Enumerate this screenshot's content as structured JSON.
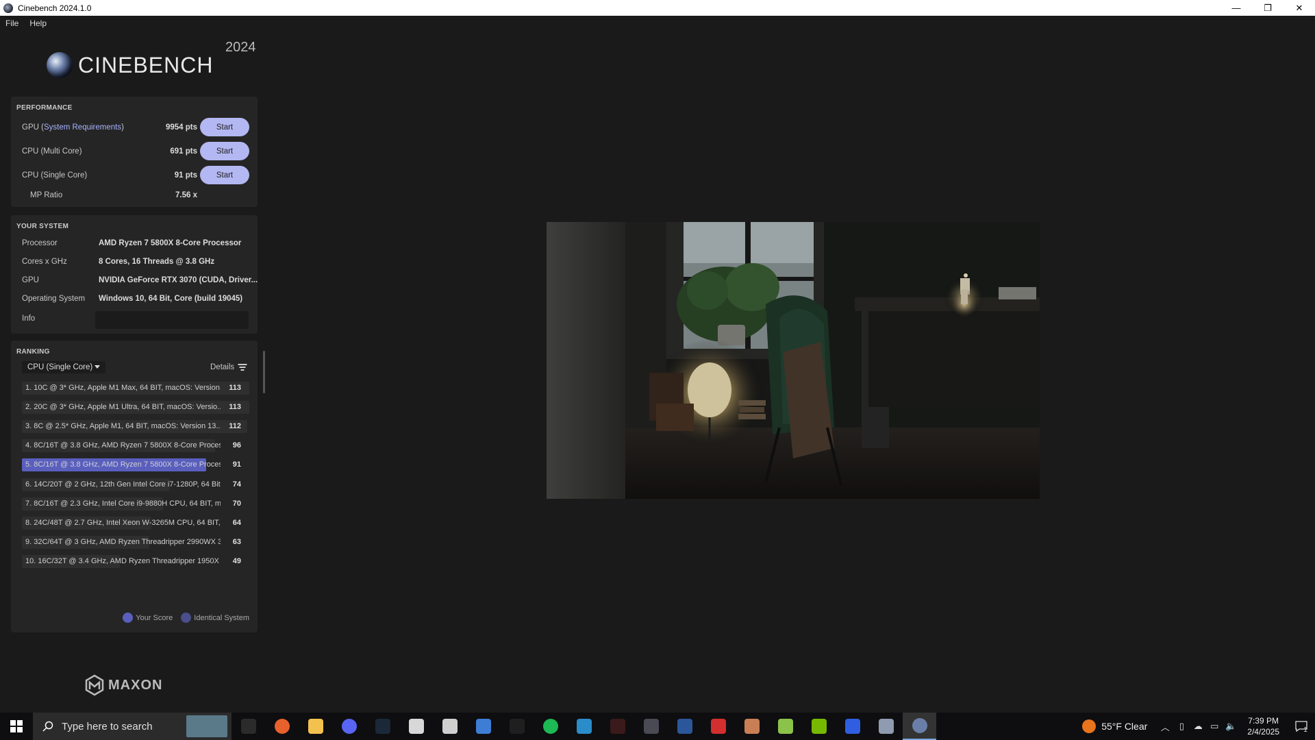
{
  "window": {
    "title": "Cinebench 2024.1.0",
    "controls": [
      "—",
      "❐",
      "✕"
    ]
  },
  "menu": [
    "File",
    "Help"
  ],
  "logo": {
    "text": "CINEBENCH",
    "year": "2024"
  },
  "performance": {
    "header": "PERFORMANCE",
    "rows": [
      {
        "label_pre": "GPU (",
        "label_link": "System Requirements",
        "label_post": ")",
        "score": "9954 pts",
        "button": "Start"
      },
      {
        "label_pre": "CPU (Multi Core)",
        "label_link": "",
        "label_post": "",
        "score": "691 pts",
        "button": "Start"
      },
      {
        "label_pre": "CPU (Single Core)",
        "label_link": "",
        "label_post": "",
        "score": "91 pts",
        "button": "Start"
      }
    ],
    "mp_label": "MP Ratio",
    "mp_value": "7.56 x"
  },
  "system": {
    "header": "YOUR SYSTEM",
    "rows": [
      {
        "label": "Processor",
        "value": "AMD Ryzen 7 5800X 8-Core Processor"
      },
      {
        "label": "Cores x GHz",
        "value": "8 Cores, 16 Threads @ 3.8 GHz"
      },
      {
        "label": "GPU",
        "value": "NVIDIA GeForce RTX 3070 (CUDA, Driver..."
      },
      {
        "label": "Operating System",
        "value": "Windows 10, 64 Bit, Core (build 19045)"
      }
    ],
    "info_label": "Info",
    "info_value": ""
  },
  "ranking": {
    "header": "RANKING",
    "selected": "CPU (Single Core)",
    "details": "Details",
    "rows": [
      {
        "text": "1. 10C @ 3* GHz, Apple M1 Max, 64 BIT, macOS: Version...",
        "score": 113,
        "fill": 1.0,
        "mine": false
      },
      {
        "text": "2. 20C @ 3* GHz, Apple M1 Ultra, 64 BIT, macOS: Versio...",
        "score": 113,
        "fill": 1.0,
        "mine": false
      },
      {
        "text": "3. 8C @ 2.5* GHz, Apple M1, 64 BIT, macOS: Version 13....",
        "score": 112,
        "fill": 0.99,
        "mine": false
      },
      {
        "text": "4. 8C/16T @ 3.8 GHz, AMD Ryzen 7 5800X 8-Core Proces...",
        "score": 96,
        "fill": 0.85,
        "mine": false
      },
      {
        "text": "5. 8C/16T @ 3.8 GHz, AMD Ryzen 7 5800X 8-Core Proces...",
        "score": 91,
        "fill": 0.81,
        "mine": true
      },
      {
        "text": "6. 14C/20T @ 2 GHz, 12th Gen Intel Core i7-1280P, 64 Bit...",
        "score": 74,
        "fill": 0.65,
        "mine": false
      },
      {
        "text": "7. 8C/16T @ 2.3 GHz, Intel Core i9-9880H CPU, 64 BIT, ma...",
        "score": 70,
        "fill": 0.62,
        "mine": false
      },
      {
        "text": "8. 24C/48T @ 2.7 GHz, Intel Xeon W-3265M CPU, 64 BIT, ...",
        "score": 64,
        "fill": 0.57,
        "mine": false
      },
      {
        "text": "9. 32C/64T @ 3 GHz, AMD Ryzen Threadripper 2990WX 3...",
        "score": 63,
        "fill": 0.56,
        "mine": false
      },
      {
        "text": "10. 16C/32T @ 3.4 GHz, AMD Ryzen Threadripper 1950X ...",
        "score": 49,
        "fill": 0.43,
        "mine": false
      }
    ],
    "legend": [
      {
        "label": "Your Score",
        "color": "#5a5fbe"
      },
      {
        "label": "Identical System",
        "color": "#4a4e8a"
      }
    ]
  },
  "maxon": {
    "text": "MAXON"
  },
  "taskbar": {
    "search_placeholder": "Type here to search",
    "apps": [
      {
        "name": "task-view-icon",
        "color": "#2b2b2b"
      },
      {
        "name": "firefox-icon",
        "color": "#e8612c"
      },
      {
        "name": "file-explorer-icon",
        "color": "#f2c14e"
      },
      {
        "name": "discord-icon",
        "color": "#5865f2"
      },
      {
        "name": "steam-icon",
        "color": "#1b2838"
      },
      {
        "name": "roblox-icon",
        "color": "#d8d8d8"
      },
      {
        "name": "roblox-studio-icon",
        "color": "#cfcfcf"
      },
      {
        "name": "contacts-icon",
        "color": "#3d7dd6"
      },
      {
        "name": "app-icon",
        "color": "#1f1f1f"
      },
      {
        "name": "spotify-icon",
        "color": "#1db954"
      },
      {
        "name": "qbittorrent-icon",
        "color": "#2a8cc9"
      },
      {
        "name": "rockstar-icon",
        "color": "#3a1a1a"
      },
      {
        "name": "game-icon",
        "color": "#4a4a55"
      },
      {
        "name": "word-icon",
        "color": "#2b579a"
      },
      {
        "name": "media-player-icon",
        "color": "#d32f2f"
      },
      {
        "name": "game-launcher-icon",
        "color": "#c97e55"
      },
      {
        "name": "bluestacks-icon",
        "color": "#8bc34a"
      },
      {
        "name": "nvidia-icon",
        "color": "#76b900"
      },
      {
        "name": "arc-icon",
        "color": "#2f5ee0"
      },
      {
        "name": "remote-icon",
        "color": "#8f9bb0"
      },
      {
        "name": "cinebench-icon",
        "color": "#6a7fa8"
      }
    ],
    "weather": "55°F  Clear",
    "time": "7:39 PM",
    "date": "2/4/2025",
    "notification_count": "1"
  }
}
